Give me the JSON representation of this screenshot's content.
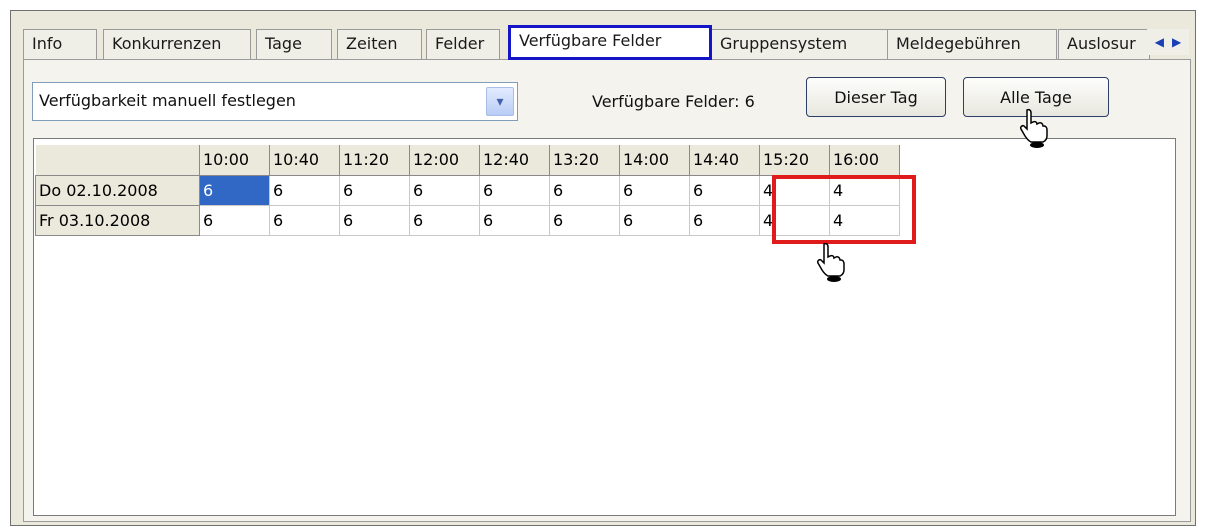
{
  "tabs": [
    {
      "label": "Info",
      "active": false
    },
    {
      "label": "Konkurrenzen",
      "active": false
    },
    {
      "label": "Tage",
      "active": false
    },
    {
      "label": "Zeiten",
      "active": false
    },
    {
      "label": "Felder",
      "active": false
    },
    {
      "label": "Verfügbare Felder",
      "active": true
    },
    {
      "label": "Gruppensystem",
      "active": false
    },
    {
      "label": "Meldegebühren",
      "active": false
    },
    {
      "label": "Auslosur",
      "active": false
    }
  ],
  "tab_scroll": {
    "left_icon": "◀",
    "right_icon": "▶"
  },
  "availability_select": {
    "value": "Verfügbarkeit manuell festlegen",
    "arrow_icon": "▾"
  },
  "available_fields_label": "Verfügbare Felder: 6",
  "buttons": {
    "this_day": "Dieser Tag",
    "all_days": "Alle Tage"
  },
  "grid": {
    "times": [
      "10:00",
      "10:40",
      "11:20",
      "12:00",
      "12:40",
      "13:20",
      "14:00",
      "14:40",
      "15:20",
      "16:00"
    ],
    "rows": [
      {
        "day": "Do 02.10.2008",
        "values": [
          "6",
          "6",
          "6",
          "6",
          "6",
          "6",
          "6",
          "6",
          "4",
          "4"
        ]
      },
      {
        "day": "Fr 03.10.2008",
        "values": [
          "6",
          "6",
          "6",
          "6",
          "6",
          "6",
          "6",
          "6",
          "4",
          "4"
        ]
      }
    ]
  },
  "colors": {
    "highlight_tab": "#1515c8",
    "highlight_cells": "#e01b1b",
    "selected_cell": "#3168c5"
  }
}
